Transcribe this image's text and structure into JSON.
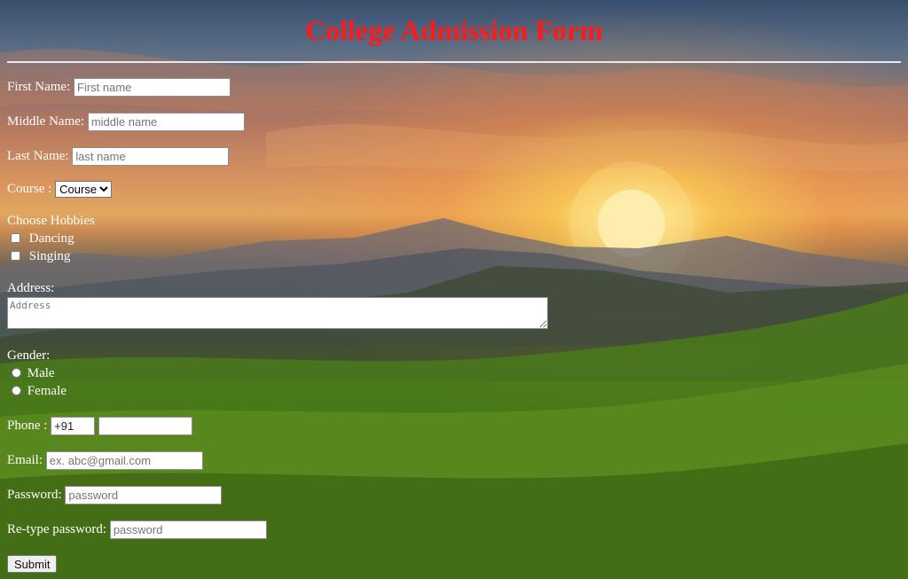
{
  "page": {
    "title": "College Admission Form"
  },
  "form": {
    "first_name": {
      "label": "First Name:",
      "placeholder": "First name",
      "value": ""
    },
    "middle_name": {
      "label": "Middle Name:",
      "placeholder": "middle name",
      "value": ""
    },
    "last_name": {
      "label": "Last Name:",
      "placeholder": "last name",
      "value": ""
    },
    "course": {
      "label": "Course :",
      "selected": "Course"
    },
    "hobbies": {
      "label": "Choose Hobbies",
      "options": [
        "Dancing",
        "Singing"
      ],
      "checked": [
        false,
        false
      ]
    },
    "address": {
      "label": "Address:",
      "placeholder": "Address",
      "value": ""
    },
    "gender": {
      "label": "Gender:",
      "options": [
        "Male",
        "Female"
      ],
      "selected": null
    },
    "phone": {
      "label": "Phone :",
      "country_code": "+91",
      "value": ""
    },
    "email": {
      "label": "Email:",
      "placeholder": "ex. abc@gmail.com",
      "value": ""
    },
    "password": {
      "label": "Password:",
      "placeholder": "password",
      "value": ""
    },
    "retype_password": {
      "label": "Re-type password:",
      "placeholder": "password",
      "value": ""
    },
    "submit_label": "Submit"
  },
  "colors": {
    "title": "#ff1a1a",
    "label_text": "#ffffff",
    "divider": "#e8e8ee"
  },
  "icons": {
    "background": "sunset-mountain-meadow-image"
  }
}
